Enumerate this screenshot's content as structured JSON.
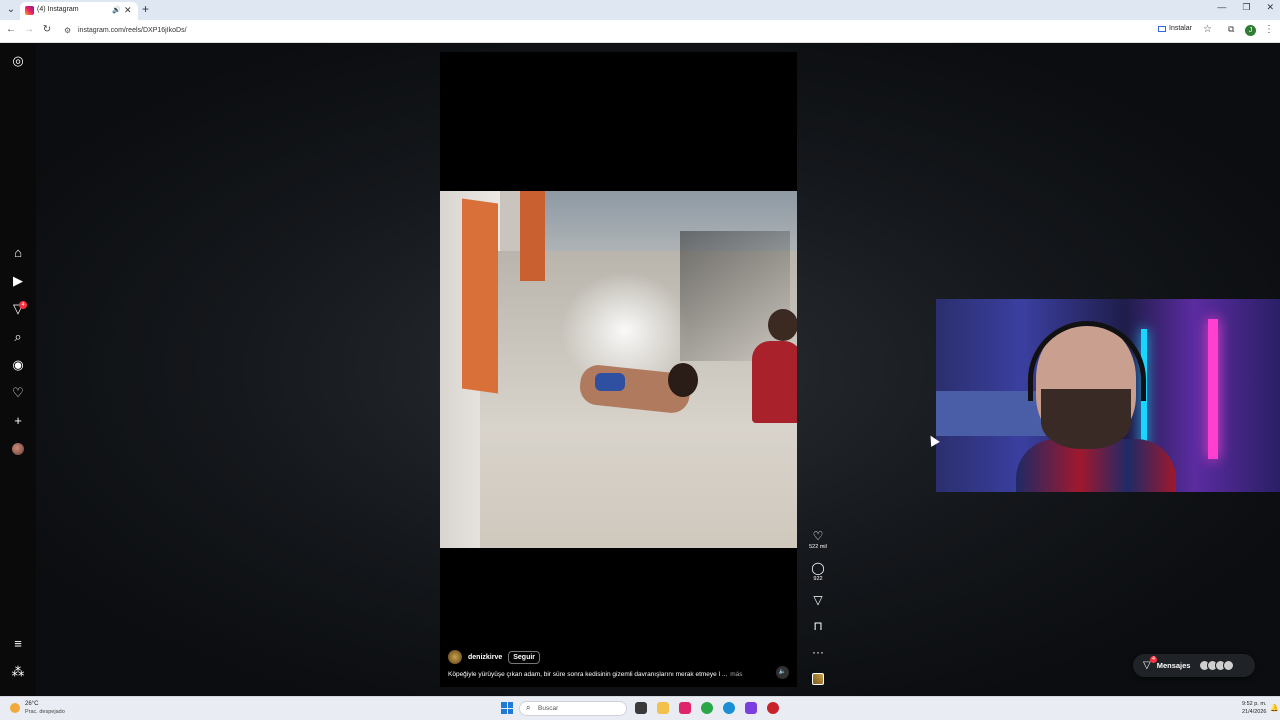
{
  "browser": {
    "tab_title": "(4) Instagram",
    "url": "instagram.com/reels/DXP16jIkoDs/",
    "install_label": "Instalar",
    "profile_initial": "J"
  },
  "sidebar": {
    "items": [
      {
        "name": "instagram-logo-icon",
        "glyph": "◎"
      },
      {
        "name": "home-icon",
        "glyph": "⌂"
      },
      {
        "name": "reels-icon",
        "glyph": "▶"
      },
      {
        "name": "messages-icon",
        "glyph": "▽"
      },
      {
        "name": "search-icon",
        "glyph": "⌕"
      },
      {
        "name": "explore-icon",
        "glyph": "◉"
      },
      {
        "name": "notifications-heart-icon",
        "glyph": "♡"
      },
      {
        "name": "create-plus-icon",
        "glyph": "+"
      },
      {
        "name": "more-menu-icon",
        "glyph": "≡"
      },
      {
        "name": "meta-apps-icon",
        "glyph": "⁂"
      }
    ],
    "messages_badge": "4"
  },
  "reel": {
    "author": "denizkirve",
    "follow_label": "Seguir",
    "caption": "Köpeğiyle yürüyüşe çıkan adam, bir süre sonra kedisinin gizemli davranışlarını merak etmeye l ...",
    "more_label": "más"
  },
  "actions": {
    "likes": "522 mil",
    "comments": "922"
  },
  "messages": {
    "label": "Mensajes",
    "badge": "4"
  },
  "taskbar": {
    "temperature": "26°C",
    "weather": "Prac. despejado",
    "search_label": "Buscar",
    "time": "9:52 p. m.",
    "date": "21/4/2026"
  }
}
